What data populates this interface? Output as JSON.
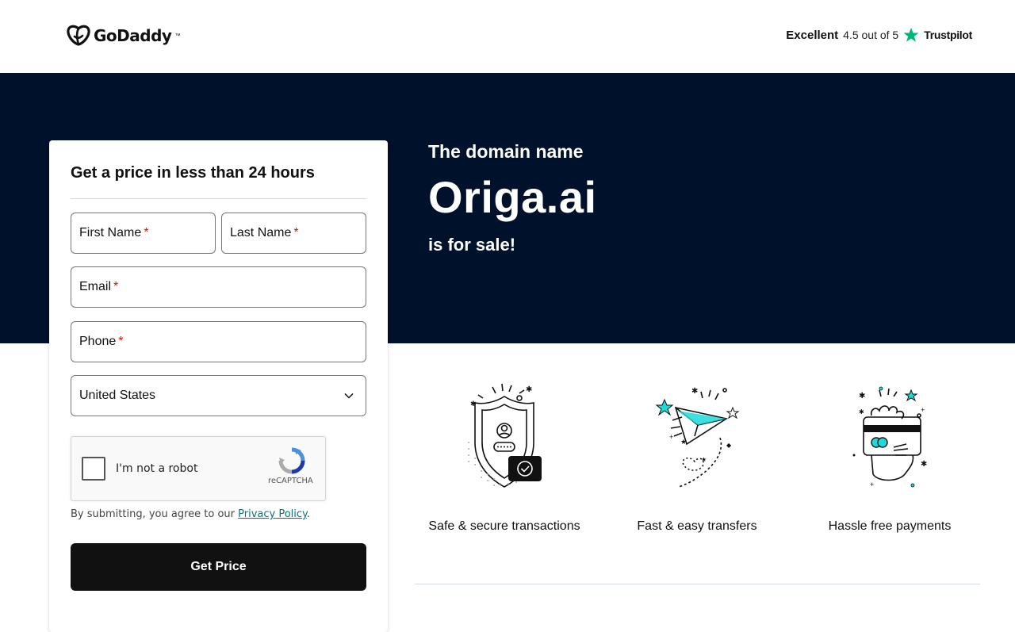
{
  "header": {
    "logo_text": "GoDaddy",
    "rating": {
      "label": "Excellent",
      "score": "4.5 out of 5",
      "provider": "Trustpilot",
      "star_color": "#00b67a"
    }
  },
  "hero": {
    "pre_title": "The domain name",
    "domain": "Origa.ai",
    "post_title": "is for sale!",
    "background": "#00112c"
  },
  "form": {
    "title": "Get a price in less than 24 hours",
    "first_name_label": "First Name",
    "last_name_label": "Last Name",
    "email_label": "Email",
    "phone_label": "Phone",
    "required_marker": "*",
    "country_selected": "United States",
    "captcha": {
      "label": "I'm not a robot",
      "brand": "reCAPTCHA"
    },
    "consent_prefix": "By submitting, you agree to our ",
    "consent_link": "Privacy Policy",
    "consent_suffix": ".",
    "submit_label": "Get Price"
  },
  "features": [
    {
      "icon": "shield-icon",
      "label": "Safe & secure transactions"
    },
    {
      "icon": "paper-plane-icon",
      "label": "Fast & easy transfers"
    },
    {
      "icon": "card-hand-icon",
      "label": "Hassle free payments"
    }
  ],
  "accent_color": "#1bdbdb"
}
